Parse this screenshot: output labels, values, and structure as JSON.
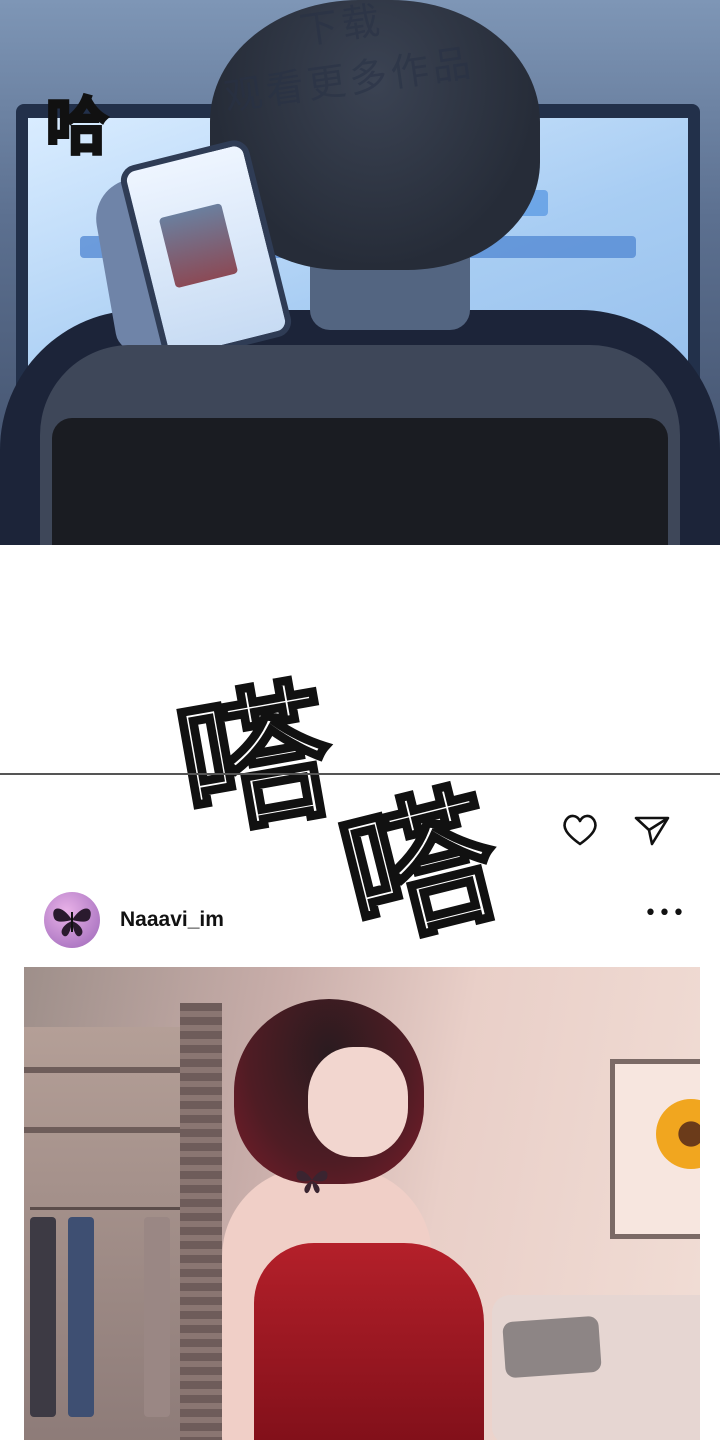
{
  "watermark": {
    "line1": "下载",
    "line2": "观看更多作品"
  },
  "sfx": {
    "laugh": "哈",
    "tap_1": "嗒",
    "tap_2": "嗒"
  },
  "post": {
    "username": "Naaavi_im",
    "more_label": "•••",
    "avatar_icon": "butterfly-icon",
    "actions": {
      "like_icon": "heart-icon",
      "share_icon": "send-icon"
    }
  },
  "colors": {
    "screen_glow": "#a8cdf3",
    "dress": "#b4202a",
    "avatar": "#b27cc6"
  }
}
